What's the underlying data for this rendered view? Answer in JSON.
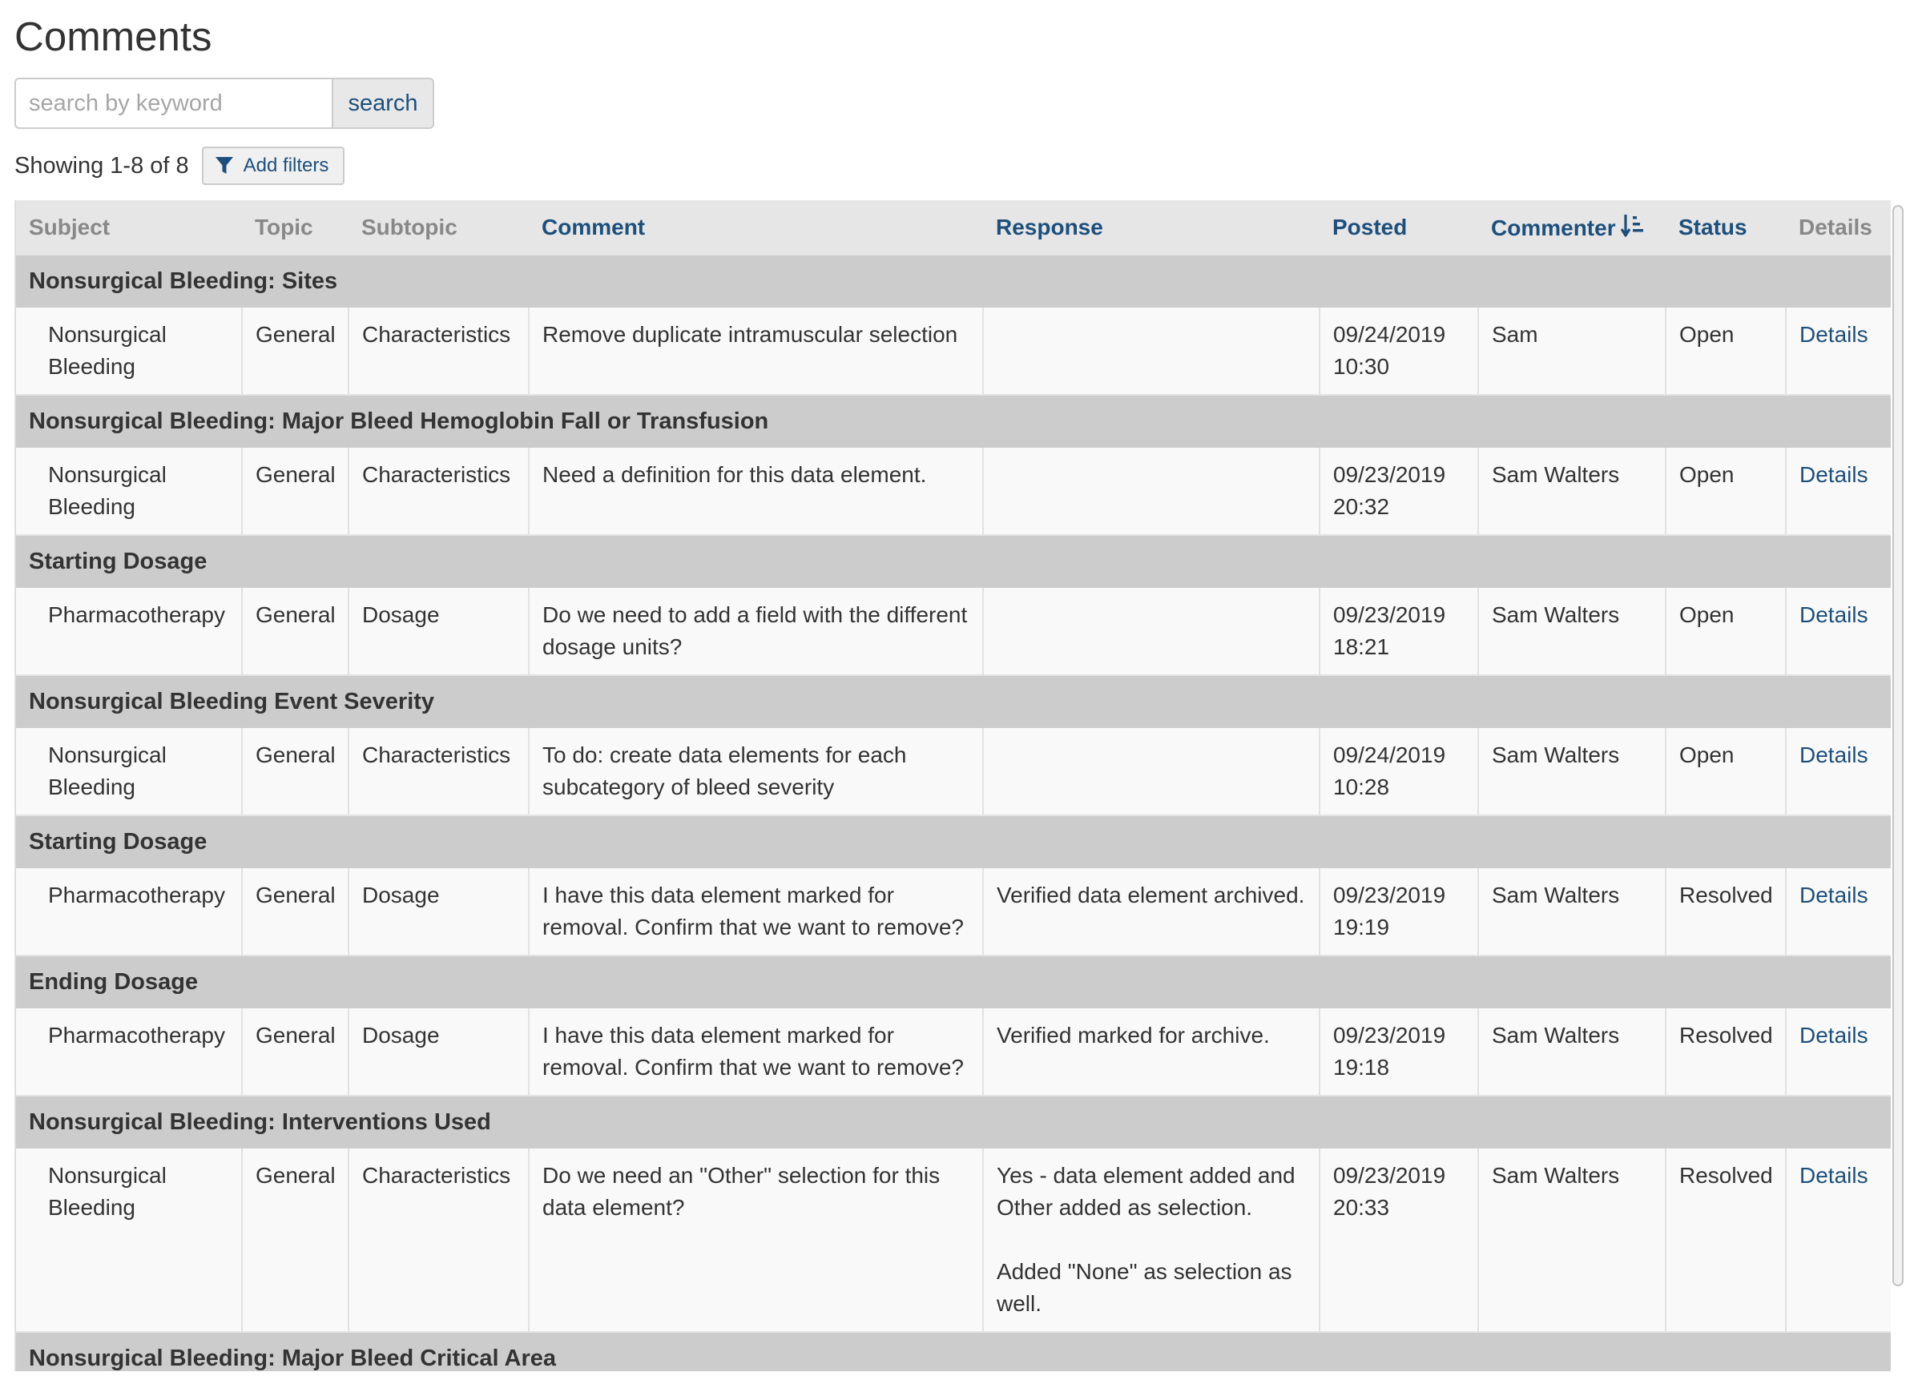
{
  "page": {
    "title": "Comments"
  },
  "search": {
    "placeholder": "search by keyword",
    "value": "",
    "button_label": "search"
  },
  "results": {
    "count_text": "Showing 1-8 of 8",
    "add_filters_label": "Add filters"
  },
  "table": {
    "headers": {
      "subject": "Subject",
      "topic": "Topic",
      "subtopic": "Subtopic",
      "comment": "Comment",
      "response": "Response",
      "posted": "Posted",
      "commenter": "Commenter",
      "status": "Status",
      "details": "Details"
    },
    "sort": {
      "column": "commenter",
      "icon": "sort-descending-icon"
    },
    "groups": [
      {
        "title": "Nonsurgical Bleeding: Sites",
        "row": {
          "subject": "Nonsurgical Bleeding",
          "topic": "General",
          "subtopic": "Characteristics",
          "comment": "Remove duplicate intramuscular selection",
          "response": [],
          "posted_date": "09/24/2019",
          "posted_time": "10:30",
          "commenter": "Sam",
          "status": "Open",
          "details": "Details"
        }
      },
      {
        "title": "Nonsurgical Bleeding: Major Bleed Hemoglobin Fall or Transfusion",
        "row": {
          "subject": "Nonsurgical Bleeding",
          "topic": "General",
          "subtopic": "Characteristics",
          "comment": "Need a definition for this data element.",
          "response": [],
          "posted_date": "09/23/2019",
          "posted_time": "20:32",
          "commenter": "Sam Walters",
          "status": "Open",
          "details": "Details"
        }
      },
      {
        "title": "Starting Dosage",
        "row": {
          "subject": "Pharmacotherapy",
          "topic": "General",
          "subtopic": "Dosage",
          "comment": "Do we need to add a field with the different dosage units?",
          "response": [],
          "posted_date": "09/23/2019",
          "posted_time": "18:21",
          "commenter": "Sam Walters",
          "status": "Open",
          "details": "Details"
        }
      },
      {
        "title": "Nonsurgical Bleeding Event Severity",
        "row": {
          "subject": "Nonsurgical Bleeding",
          "topic": "General",
          "subtopic": "Characteristics",
          "comment": "To do: create data elements for each subcategory of bleed severity",
          "response": [],
          "posted_date": "09/24/2019",
          "posted_time": "10:28",
          "commenter": "Sam Walters",
          "status": "Open",
          "details": "Details"
        }
      },
      {
        "title": "Starting Dosage",
        "row": {
          "subject": "Pharmacotherapy",
          "topic": "General",
          "subtopic": "Dosage",
          "comment": "I have this data element marked for removal. Confirm that we want to remove?",
          "response": [
            "Verified data element archived."
          ],
          "posted_date": "09/23/2019",
          "posted_time": "19:19",
          "commenter": "Sam Walters",
          "status": "Resolved",
          "details": "Details"
        }
      },
      {
        "title": "Ending Dosage",
        "row": {
          "subject": "Pharmacotherapy",
          "topic": "General",
          "subtopic": "Dosage",
          "comment": "I have this data element marked for removal. Confirm that we want to remove?",
          "response": [
            "Verified marked for archive."
          ],
          "posted_date": "09/23/2019",
          "posted_time": "19:18",
          "commenter": "Sam Walters",
          "status": "Resolved",
          "details": "Details"
        }
      },
      {
        "title": "Nonsurgical Bleeding: Interventions Used",
        "row": {
          "subject": "Nonsurgical Bleeding",
          "topic": "General",
          "subtopic": "Characteristics",
          "comment": "Do we need an \"Other\" selection for this data element?",
          "response": [
            "Yes - data element added and Other added as selection.",
            "Added \"None\" as selection as well."
          ],
          "posted_date": "09/23/2019",
          "posted_time": "20:33",
          "commenter": "Sam Walters",
          "status": "Resolved",
          "details": "Details"
        }
      },
      {
        "title": "Nonsurgical Bleeding: Major Bleed Critical Area",
        "row": null
      }
    ]
  },
  "icons": {
    "filter": "filter-icon",
    "sort": "sort-descending-icon"
  },
  "colors": {
    "link": "#1d4f7c",
    "header_bg": "#e6e6e6",
    "group_bg": "#cccccc",
    "row_bg": "#f9f9f9"
  }
}
